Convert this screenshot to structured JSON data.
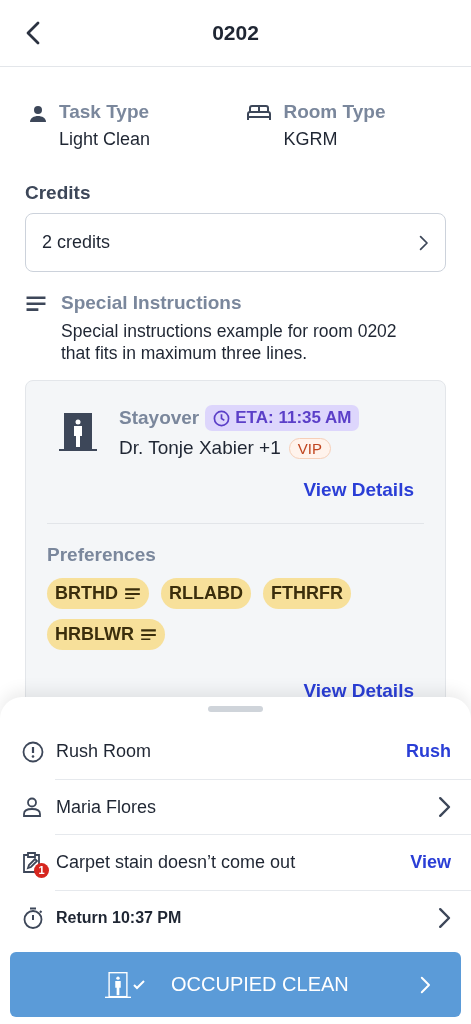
{
  "header": {
    "title": "0202"
  },
  "info": [
    {
      "kind": "person",
      "label": "Task Type",
      "value": "Light Clean"
    },
    {
      "kind": "bed",
      "label": "Room Type",
      "value": "KGRM"
    }
  ],
  "credits": {
    "label": "Credits",
    "value": "2 credits"
  },
  "special_instructions": {
    "label": "Special Instructions",
    "text": "Special instructions example for room 0202 that fits in maximum three lines."
  },
  "guest_card": {
    "status": "Stayover",
    "eta": "ETA: 11:35 AM",
    "guest": "Dr. Tonje Xabier +1",
    "badge": "VIP",
    "link": "View Details",
    "preferences_label": "Preferences",
    "preferences": [
      {
        "code": "BRTHD",
        "has_note": true
      },
      {
        "code": "RLLABD",
        "has_note": false
      },
      {
        "code": "FTHRFR",
        "has_note": false
      },
      {
        "code": "HRBLWR",
        "has_note": true
      }
    ],
    "link_2": "View Details"
  },
  "sheet": {
    "rows": [
      {
        "kind": "alert",
        "text": "Rush Room",
        "action": "Rush"
      },
      {
        "kind": "person",
        "text": "Maria Flores"
      },
      {
        "kind": "note",
        "text": "Carpet stain doesn’t come out",
        "badge": "1",
        "action": "View"
      },
      {
        "kind": "timer",
        "text": "Return 10:37 PM",
        "bold": true
      }
    ],
    "button": "OCCUPIED CLEAN"
  }
}
